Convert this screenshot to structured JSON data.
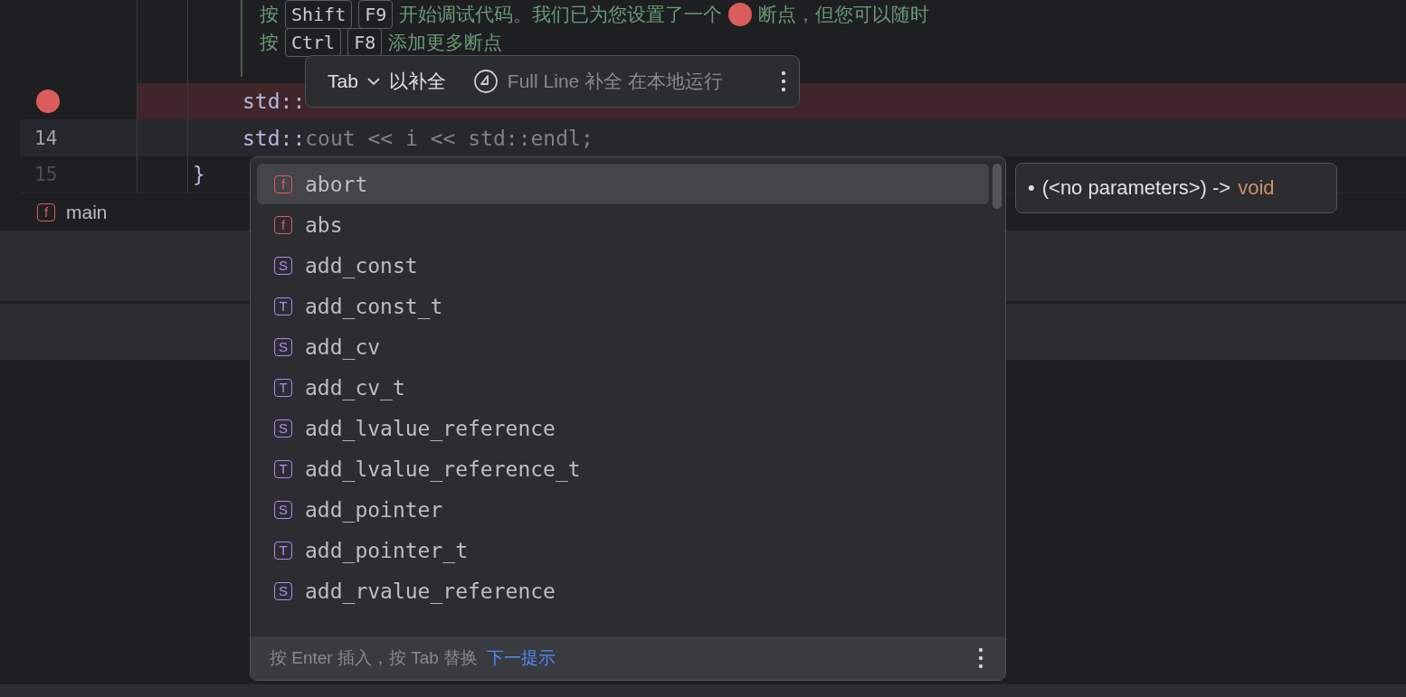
{
  "editor": {
    "hint_lines": [
      {
        "parts": [
          {
            "kind": "text",
            "text": "按"
          },
          {
            "kind": "key",
            "text": "Shift"
          },
          {
            "kind": "key",
            "text": "F9"
          },
          {
            "kind": "text",
            "text": "开始调试代码。我们已为您设置了一个"
          },
          {
            "kind": "dot"
          },
          {
            "kind": "text",
            "text": "断点，但您可以随时"
          }
        ]
      },
      {
        "parts": [
          {
            "kind": "text",
            "text": "按"
          },
          {
            "kind": "key",
            "text": "Ctrl"
          },
          {
            "kind": "key",
            "text": "F8"
          },
          {
            "kind": "text",
            "text": "添加更多断点"
          }
        ]
      }
    ],
    "lines": [
      {
        "breakpoint": true,
        "current": false,
        "kind": "statement",
        "code": [
          {
            "kind": "typed",
            "text": "std::"
          }
        ]
      },
      {
        "number": "14",
        "breakpoint": false,
        "current": true,
        "kind": "statement",
        "code": [
          {
            "kind": "typed",
            "text": "std::"
          },
          {
            "kind": "ghost",
            "text": "cout << i << std::endl;"
          }
        ]
      },
      {
        "number": "15",
        "breakpoint": false,
        "current": false,
        "kind": "closing_brace",
        "code": [
          {
            "kind": "typed",
            "text": "}"
          }
        ]
      }
    ],
    "breadcrumb": {
      "icon": "f",
      "kind": "function",
      "label": "main"
    }
  },
  "inline_hint": {
    "key": "Tab",
    "action": "以补全",
    "info": "Full Line 补全 在本地运行"
  },
  "completion": {
    "items": [
      {
        "kind": "function",
        "icon": "f",
        "label": "abort",
        "selected": true
      },
      {
        "kind": "function",
        "icon": "f",
        "label": "abs",
        "selected": false
      },
      {
        "kind": "struct",
        "icon": "S",
        "label": "add_const",
        "selected": false
      },
      {
        "kind": "type",
        "icon": "T",
        "label": "add_const_t",
        "selected": false
      },
      {
        "kind": "struct",
        "icon": "S",
        "label": "add_cv",
        "selected": false
      },
      {
        "kind": "type",
        "icon": "T",
        "label": "add_cv_t",
        "selected": false
      },
      {
        "kind": "struct",
        "icon": "S",
        "label": "add_lvalue_reference",
        "selected": false
      },
      {
        "kind": "type",
        "icon": "T",
        "label": "add_lvalue_reference_t",
        "selected": false
      },
      {
        "kind": "struct",
        "icon": "S",
        "label": "add_pointer",
        "selected": false
      },
      {
        "kind": "type",
        "icon": "T",
        "label": "add_pointer_t",
        "selected": false
      },
      {
        "kind": "struct",
        "icon": "S",
        "label": "add_rvalue_reference",
        "selected": false
      }
    ],
    "footer_text": "按 Enter 插入，按 Tab 替换",
    "footer_link": "下一提示"
  },
  "tooltip": {
    "bullet": "•",
    "signature": "(<no parameters>) ->",
    "return_type": "void"
  }
}
